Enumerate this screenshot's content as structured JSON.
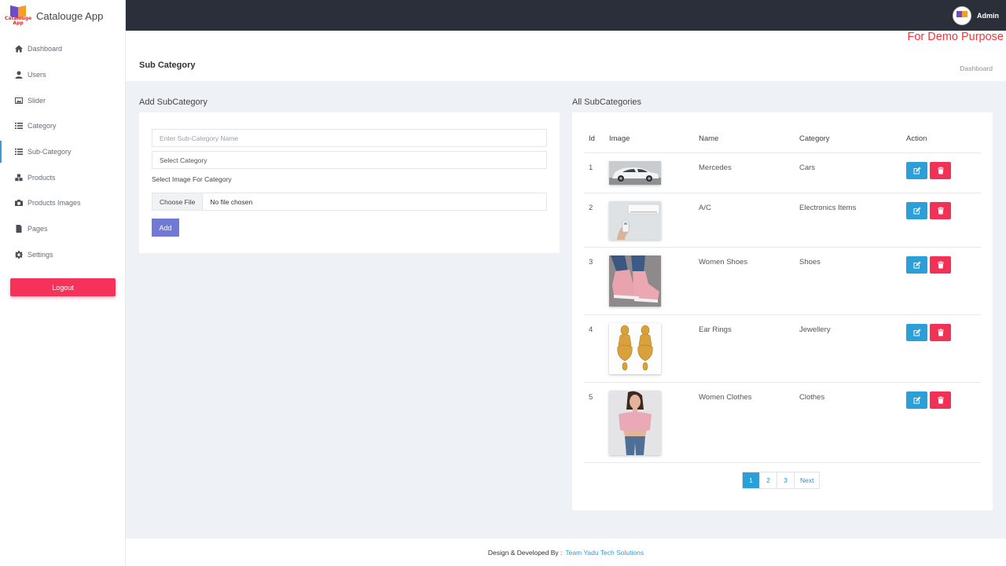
{
  "app": {
    "name": "Catalouge App",
    "logo_text": "Catalouge App"
  },
  "topbar": {
    "user": "Admin",
    "avatar_text": "Catalouge App"
  },
  "banner": "For Demo Purpose",
  "page": {
    "title": "Sub Category",
    "breadcrumb": "Dashboard"
  },
  "sidebar": {
    "items": [
      {
        "label": "Dashboard",
        "icon": "home-icon"
      },
      {
        "label": "Users",
        "icon": "user-icon"
      },
      {
        "label": "Slider",
        "icon": "image-icon"
      },
      {
        "label": "Category",
        "icon": "list-icon"
      },
      {
        "label": "Sub-Category",
        "icon": "list-icon",
        "active": true
      },
      {
        "label": "Products",
        "icon": "cubes-icon"
      },
      {
        "label": "Products Images",
        "icon": "camera-icon"
      },
      {
        "label": "Pages",
        "icon": "file-icon"
      },
      {
        "label": "Settings",
        "icon": "gear-icon"
      }
    ],
    "logout": "Logout"
  },
  "form": {
    "title": "Add SubCategory",
    "name_placeholder": "Enter Sub-Category Name",
    "category_select": "Select Category",
    "image_label": "Select Image For Category",
    "file_button": "Choose File",
    "file_status": "No file chosen",
    "submit": "Add"
  },
  "table": {
    "title": "All SubCategories",
    "headers": [
      "Id",
      "Image",
      "Name",
      "Category",
      "Action"
    ],
    "rows": [
      {
        "id": "1",
        "name": "Mercedes",
        "category": "Cars",
        "image": "car"
      },
      {
        "id": "2",
        "name": "A/C",
        "category": "Electronics Items",
        "image": "ac"
      },
      {
        "id": "3",
        "name": "Women Shoes",
        "category": "Shoes",
        "image": "shoes"
      },
      {
        "id": "4",
        "name": "Ear Rings",
        "category": "Jewellery",
        "image": "earrings"
      },
      {
        "id": "5",
        "name": "Women Clothes",
        "category": "Clothes",
        "image": "clothes"
      }
    ]
  },
  "pagination": {
    "pages": [
      "1",
      "2",
      "3"
    ],
    "active": "1",
    "next": "Next"
  },
  "footer": {
    "text": "Design & Developed By :",
    "link": "Team Yadu Tech Solutions"
  },
  "colors": {
    "accent": "#2a9fd8",
    "danger": "#f23157",
    "topbar": "#2b2f3a",
    "primary_btn": "#7079d3"
  }
}
